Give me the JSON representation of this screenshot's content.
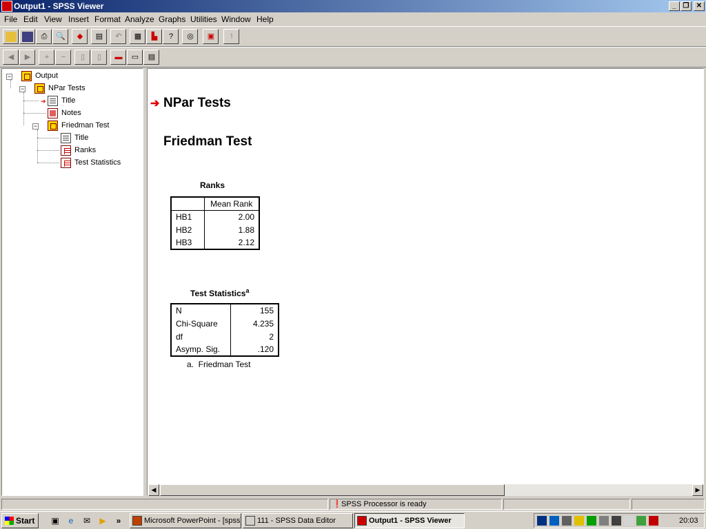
{
  "window": {
    "title": "Output1 - SPSS Viewer"
  },
  "menu": [
    "File",
    "Edit",
    "View",
    "Insert",
    "Format",
    "Analyze",
    "Graphs",
    "Utilities",
    "Window",
    "Help"
  ],
  "outline": {
    "items": [
      {
        "label": "Output",
        "icon": "book-icon"
      },
      {
        "label": "NPar Tests",
        "icon": "book-icon"
      },
      {
        "label": "Title",
        "icon": "title-doc-icon"
      },
      {
        "label": "Notes",
        "icon": "notes-icon"
      },
      {
        "label": "Friedman Test",
        "icon": "book-icon"
      },
      {
        "label": "Title",
        "icon": "title-doc-icon"
      },
      {
        "label": "Ranks",
        "icon": "table-icon"
      },
      {
        "label": "Test Statistics",
        "icon": "table-icon"
      }
    ]
  },
  "content": {
    "heading": "NPar Tests",
    "subheading": "Friedman Test",
    "ranks": {
      "title": "Ranks",
      "column": "Mean Rank",
      "rows": [
        {
          "label": "HB1",
          "value": "2.00"
        },
        {
          "label": "HB2",
          "value": "1.88"
        },
        {
          "label": "HB3",
          "value": "2.12"
        }
      ]
    },
    "test_statistics": {
      "title": "Test Statistics",
      "superscript": "a",
      "rows": [
        {
          "label": "N",
          "value": "155"
        },
        {
          "label": "Chi-Square",
          "value": "4.235"
        },
        {
          "label": "df",
          "value": "2"
        },
        {
          "label": "Asymp. Sig.",
          "value": ".120"
        }
      ],
      "footnote": "a.  Friedman Test"
    }
  },
  "status": {
    "text": "SPSS Processor  is ready"
  },
  "taskbar": {
    "start": "Start",
    "tasks": [
      {
        "label": "Microsoft PowerPoint - [spss]"
      },
      {
        "label": "111 - SPSS Data Editor"
      },
      {
        "label": "Output1 - SPSS Viewer"
      }
    ],
    "clock": "20:03"
  },
  "colors": {
    "titlebar_start": "#0a246a",
    "titlebar_end": "#a6caf0",
    "arrow": "#e00000"
  }
}
